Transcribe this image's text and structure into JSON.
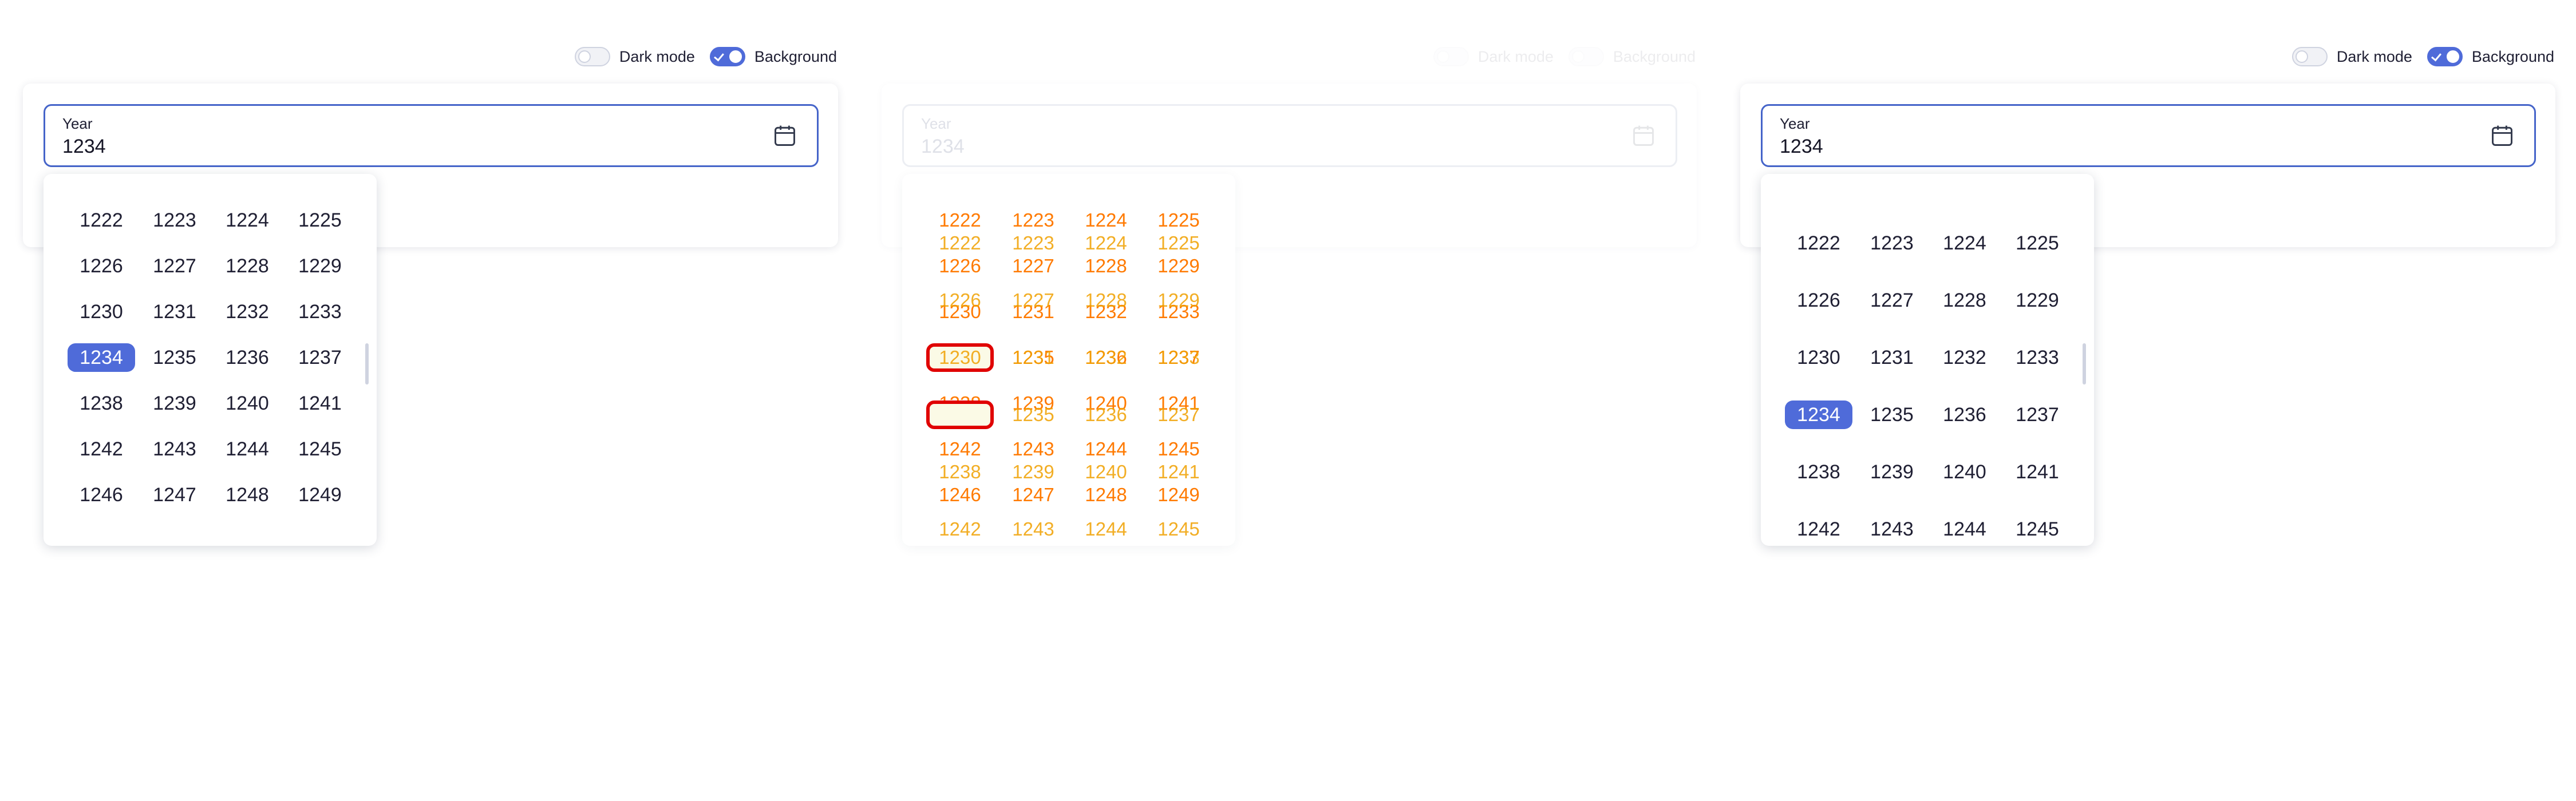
{
  "toggles": {
    "dark_mode": {
      "label": "Dark mode",
      "on": false
    },
    "background": {
      "label": "Background",
      "on": true
    }
  },
  "field": {
    "label": "Year",
    "value": "1234"
  },
  "picker": {
    "selected": "1234",
    "years": [
      "1222",
      "1223",
      "1224",
      "1225",
      "1226",
      "1227",
      "1228",
      "1229",
      "1230",
      "1231",
      "1232",
      "1233",
      "1234",
      "1235",
      "1236",
      "1237",
      "1238",
      "1239",
      "1240",
      "1241",
      "1242",
      "1243",
      "1244",
      "1245",
      "1246",
      "1247",
      "1248",
      "1249"
    ]
  },
  "colors": {
    "accent": "#4f6bd9",
    "field_border": "#4564c9",
    "diff_text": "#ff7a00",
    "diff_highlight": "#e00000"
  }
}
